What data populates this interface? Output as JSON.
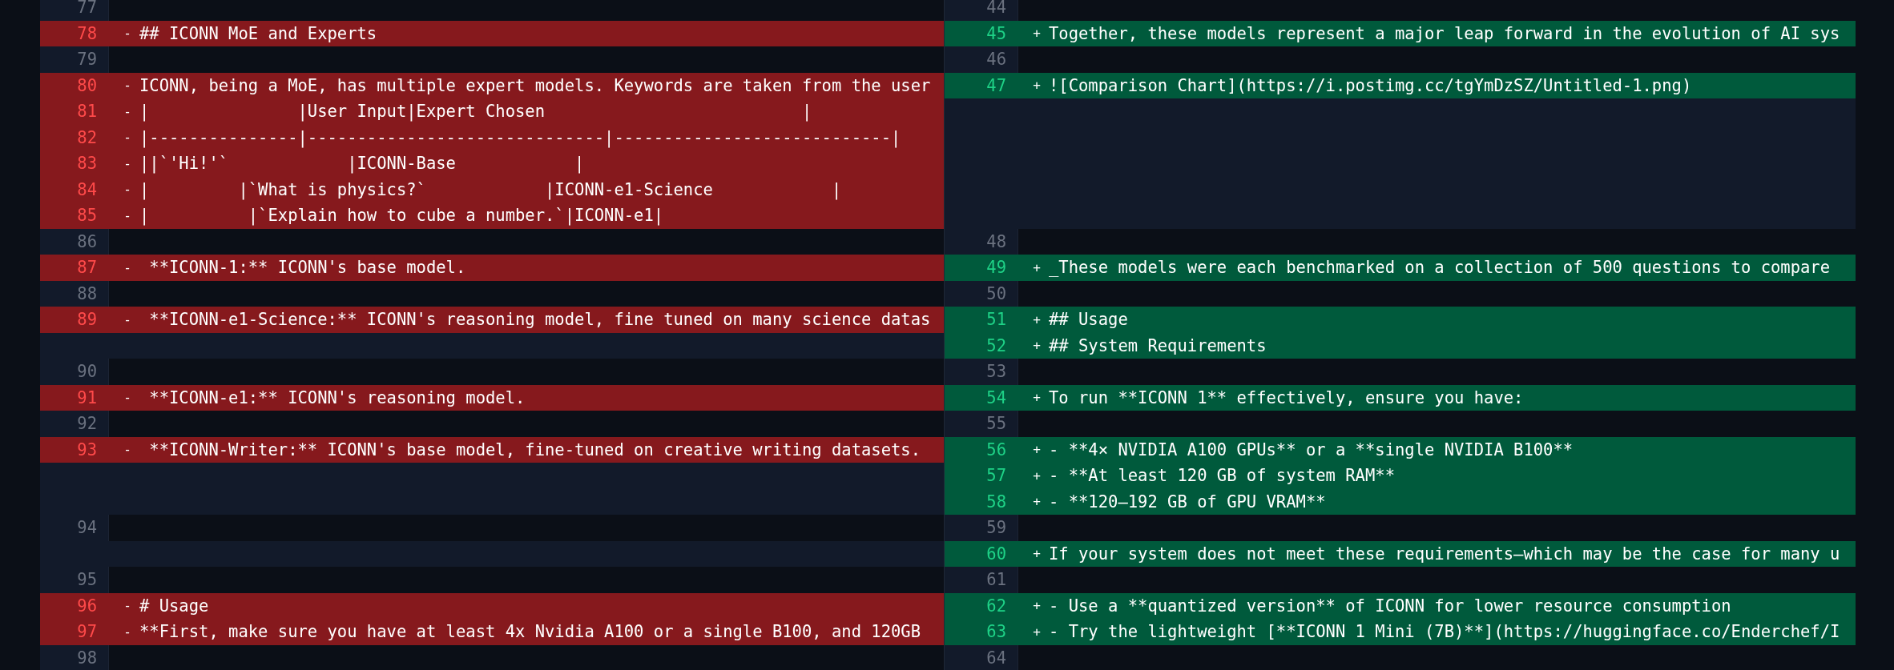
{
  "left_pane": {
    "rows": [
      {
        "kind": "context",
        "number": "77"
      },
      {
        "kind": "removed",
        "number": "78",
        "sign": "-",
        "text": "## ICONN MoE and Experts"
      },
      {
        "kind": "context",
        "number": "79"
      },
      {
        "kind": "removed",
        "number": "80",
        "sign": "-",
        "text": "ICONN, being a MoE, has multiple expert models. Keywords are taken from the user"
      },
      {
        "kind": "removed",
        "number": "81",
        "sign": "-",
        "text": "|               |User Input|Expert Chosen                          |"
      },
      {
        "kind": "removed",
        "number": "82",
        "sign": "-",
        "text": "|---------------|------------------------------|----------------------------|"
      },
      {
        "kind": "removed",
        "number": "83",
        "sign": "-",
        "text": "||`'Hi!'`            |ICONN-Base            |"
      },
      {
        "kind": "removed",
        "number": "84",
        "sign": "-",
        "text": "|         |`What is physics?`            |ICONN-e1-Science            |"
      },
      {
        "kind": "removed",
        "number": "85",
        "sign": "-",
        "text": "|          |`Explain how to cube a number.`|ICONN-e1|"
      },
      {
        "kind": "context",
        "number": "86"
      },
      {
        "kind": "removed",
        "number": "87",
        "sign": "-",
        "text": " **ICONN-1:** ICONN's base model."
      },
      {
        "kind": "context",
        "number": "88"
      },
      {
        "kind": "removed",
        "number": "89",
        "sign": "-",
        "text": " **ICONN-e1-Science:** ICONN's reasoning model, fine tuned on many science datas"
      },
      {
        "kind": "filler"
      },
      {
        "kind": "context",
        "number": "90"
      },
      {
        "kind": "removed",
        "number": "91",
        "sign": "-",
        "text": " **ICONN-e1:** ICONN's reasoning model."
      },
      {
        "kind": "context",
        "number": "92"
      },
      {
        "kind": "removed",
        "number": "93",
        "sign": "-",
        "text": " **ICONN-Writer:** ICONN's base model, fine-tuned on creative writing datasets."
      },
      {
        "kind": "filler"
      },
      {
        "kind": "filler"
      },
      {
        "kind": "context",
        "number": "94"
      },
      {
        "kind": "filler"
      },
      {
        "kind": "context",
        "number": "95"
      },
      {
        "kind": "removed",
        "number": "96",
        "sign": "-",
        "text": "# Usage"
      },
      {
        "kind": "removed",
        "number": "97",
        "sign": "-",
        "text": "**First, make sure you have at least 4x Nvidia A100 or a single B100, and 120GB"
      },
      {
        "kind": "context",
        "number": "98"
      }
    ]
  },
  "right_pane": {
    "rows": [
      {
        "kind": "context",
        "number": "44"
      },
      {
        "kind": "added",
        "number": "45",
        "sign": "+",
        "text": "Together, these models represent a major leap forward in the evolution of AI sys"
      },
      {
        "kind": "context",
        "number": "46"
      },
      {
        "kind": "added",
        "number": "47",
        "sign": "+",
        "text": "![Comparison Chart](https://i.postimg.cc/tgYmDzSZ/Untitled-1.png)"
      },
      {
        "kind": "filler"
      },
      {
        "kind": "filler"
      },
      {
        "kind": "filler"
      },
      {
        "kind": "filler"
      },
      {
        "kind": "filler"
      },
      {
        "kind": "context",
        "number": "48"
      },
      {
        "kind": "added",
        "number": "49",
        "sign": "+",
        "text": "_These models were each benchmarked on a collection of 500 questions to compare"
      },
      {
        "kind": "context",
        "number": "50"
      },
      {
        "kind": "added",
        "number": "51",
        "sign": "+",
        "text": "## Usage"
      },
      {
        "kind": "added",
        "number": "52",
        "sign": "+",
        "text": "## System Requirements"
      },
      {
        "kind": "context",
        "number": "53"
      },
      {
        "kind": "added",
        "number": "54",
        "sign": "+",
        "text": "To run **ICONN 1** effectively, ensure you have:"
      },
      {
        "kind": "context",
        "number": "55"
      },
      {
        "kind": "added",
        "number": "56",
        "sign": "+",
        "text": "- **4× NVIDIA A100 GPUs** or a **single NVIDIA B100**"
      },
      {
        "kind": "added",
        "number": "57",
        "sign": "+",
        "text": "- **At least 120 GB of system RAM**"
      },
      {
        "kind": "added",
        "number": "58",
        "sign": "+",
        "text": "- **120–192 GB of GPU VRAM**"
      },
      {
        "kind": "context",
        "number": "59"
      },
      {
        "kind": "added",
        "number": "60",
        "sign": "+",
        "text": "If your system does not meet these requirements—which may be the case for many u"
      },
      {
        "kind": "context",
        "number": "61"
      },
      {
        "kind": "added",
        "number": "62",
        "sign": "+",
        "text": "- Use a **quantized version** of ICONN for lower resource consumption"
      },
      {
        "kind": "added",
        "number": "63",
        "sign": "+",
        "text": "- Try the lightweight [**ICONN 1 Mini (7B)**](https://huggingface.co/Enderchef/I"
      },
      {
        "kind": "context",
        "number": "64"
      }
    ]
  }
}
